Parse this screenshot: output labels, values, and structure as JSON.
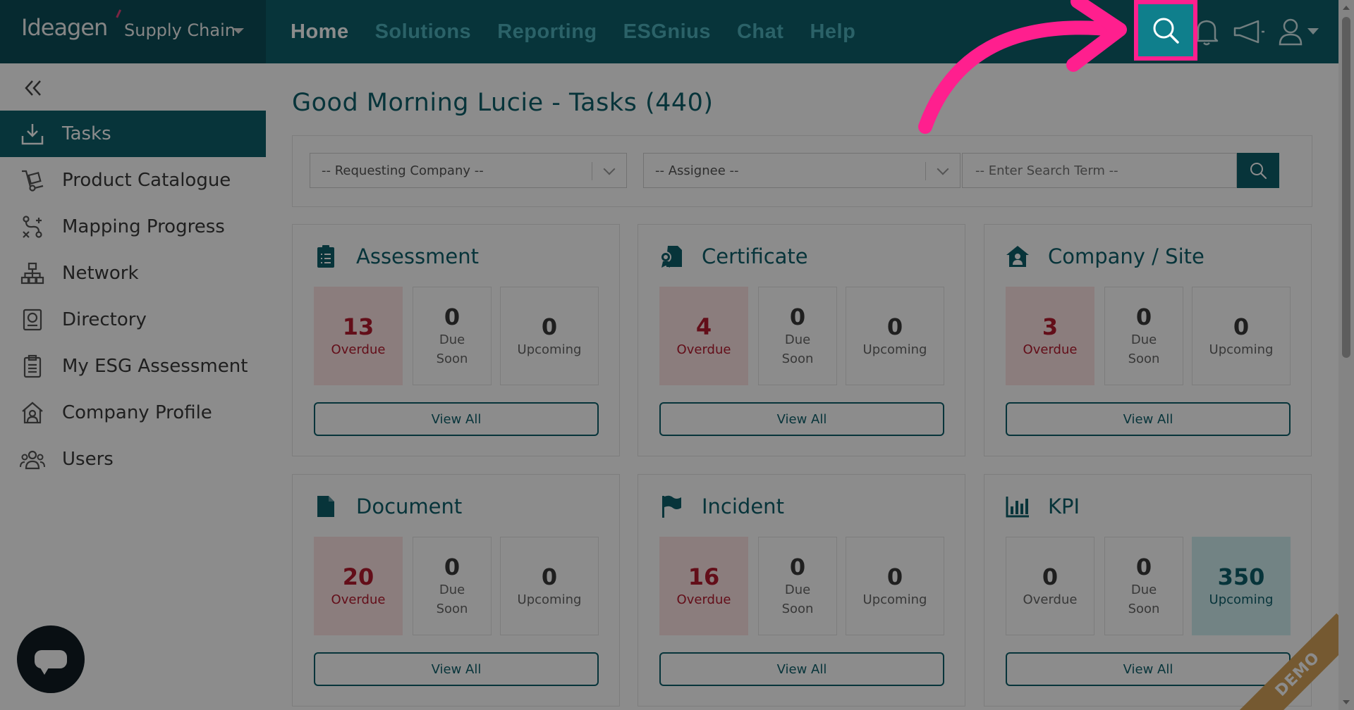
{
  "brand": {
    "logo": "Ideagen",
    "product": "Supply Chain"
  },
  "nav": {
    "items": [
      {
        "label": "Home",
        "active": true
      },
      {
        "label": "Solutions",
        "active": false
      },
      {
        "label": "Reporting",
        "active": false
      },
      {
        "label": "ESGnius",
        "active": false
      },
      {
        "label": "Chat",
        "active": false
      },
      {
        "label": "Help",
        "active": false
      }
    ]
  },
  "sidebar": {
    "items": [
      {
        "label": "Tasks",
        "icon": "download-tray-icon",
        "active": true
      },
      {
        "label": "Product Catalogue",
        "icon": "hand-truck-icon"
      },
      {
        "label": "Mapping Progress",
        "icon": "mapping-icon"
      },
      {
        "label": "Network",
        "icon": "network-icon"
      },
      {
        "label": "Directory",
        "icon": "directory-icon"
      },
      {
        "label": "My ESG Assessment",
        "icon": "clipboard-icon"
      },
      {
        "label": "Company Profile",
        "icon": "company-icon"
      },
      {
        "label": "Users",
        "icon": "users-icon"
      }
    ]
  },
  "main": {
    "greeting": "Good Morning Lucie - Tasks (440)",
    "filters": {
      "company_placeholder": "-- Requesting Company --",
      "assignee_placeholder": "-- Assignee --",
      "search_placeholder": "-- Enter Search Term --"
    },
    "labels": {
      "overdue": "Overdue",
      "due": "Due",
      "soon": "Soon",
      "upcoming": "Upcoming",
      "view_all": "View All"
    },
    "cards": [
      {
        "title": "Assessment",
        "icon": "clipboard-list-icon",
        "overdue": "13",
        "due_soon": "0",
        "upcoming": "0"
      },
      {
        "title": "Certificate",
        "icon": "certificate-icon",
        "overdue": "4",
        "due_soon": "0",
        "upcoming": "0"
      },
      {
        "title": "Company / Site",
        "icon": "house-icon",
        "overdue": "3",
        "due_soon": "0",
        "upcoming": "0"
      },
      {
        "title": "Document",
        "icon": "document-icon",
        "overdue": "20",
        "due_soon": "0",
        "upcoming": "0"
      },
      {
        "title": "Incident",
        "icon": "flag-icon",
        "overdue": "16",
        "due_soon": "0",
        "upcoming": "0"
      },
      {
        "title": "KPI",
        "icon": "bar-chart-icon",
        "overdue": "0",
        "due_soon": "0",
        "upcoming": "350"
      }
    ]
  },
  "ribbon": "DEMO",
  "colors": {
    "primary": "#0e5f6b",
    "nav_inactive": "#4fb3be",
    "overdue": "#b51a2e",
    "highlight": "#ff1f8e"
  }
}
